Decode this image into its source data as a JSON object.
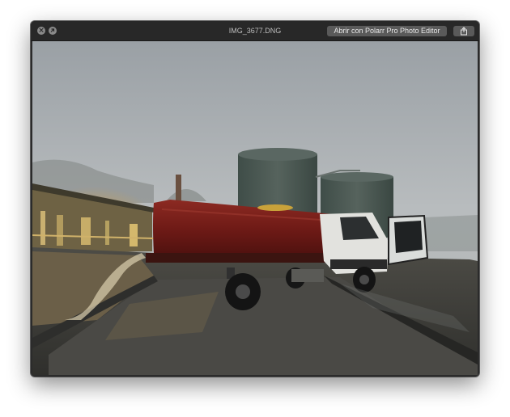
{
  "window": {
    "title": "IMG_3677.DNG",
    "open_with_label": "Abrir con Polarr Pro Photo Editor"
  },
  "icons": {
    "close": "close-icon",
    "minimize": "fullscreen-icon",
    "share": "share-icon"
  },
  "photo": {
    "subject": "red water tanker truck discharging water beside two storage tanks in fog"
  },
  "colors": {
    "titlebar": "#282828",
    "button": "#5a5a5a",
    "truck_tank": "#7a1e19"
  }
}
